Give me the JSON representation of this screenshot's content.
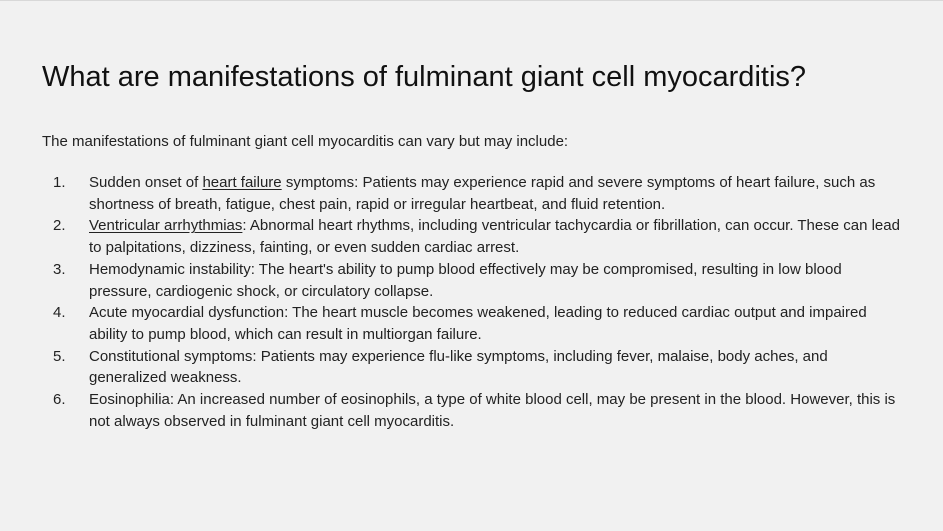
{
  "title": "What are manifestations of fulminant giant cell myocarditis?",
  "intro": "The manifestations of fulminant giant cell myocarditis can vary but may include:",
  "items": [
    {
      "number": "1.",
      "pre": "Sudden onset of ",
      "link": "heart failure",
      "post": " symptoms: Patients may experience rapid and severe symptoms of heart failure, such as shortness of breath, fatigue, chest pain, rapid or irregular heartbeat, and fluid retention."
    },
    {
      "number": "2.",
      "pre": "",
      "link": "Ventricular arrhythmias",
      "post": ": Abnormal heart rhythms, including ventricular tachycardia or fibrillation, can occur. These can lead to palpitations, dizziness, fainting, or even sudden cardiac arrest."
    },
    {
      "number": "3.",
      "text": "Hemodynamic instability: The heart's ability to pump blood effectively may be compromised, resulting in low blood pressure, cardiogenic shock, or circulatory collapse."
    },
    {
      "number": "4.",
      "text": "Acute myocardial dysfunction: The heart muscle becomes weakened, leading to reduced cardiac output and impaired ability to pump blood, which can result in multiorgan failure."
    },
    {
      "number": "5.",
      "text": "Constitutional symptoms: Patients may experience flu-like symptoms, including fever, malaise, body aches, and generalized weakness."
    },
    {
      "number": "6.",
      "text": "Eosinophilia: An increased number of eosinophils, a type of white blood cell, may be present in the blood. However, this is not always observed in fulminant giant cell myocarditis."
    }
  ]
}
